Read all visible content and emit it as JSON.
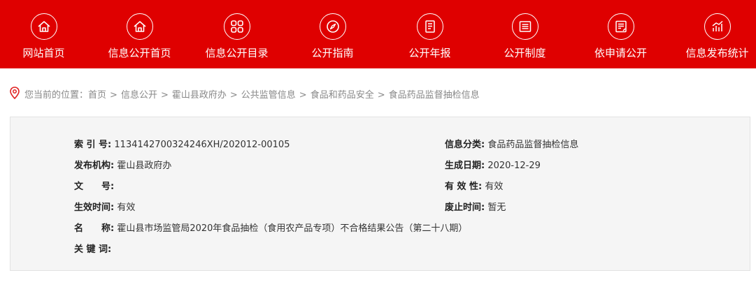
{
  "nav": {
    "items": [
      {
        "label": "网站首页",
        "icon": "home-icon"
      },
      {
        "label": "信息公开首页",
        "icon": "home-icon"
      },
      {
        "label": "信息公开目录",
        "icon": "grid-icon"
      },
      {
        "label": "公开指南",
        "icon": "compass-icon"
      },
      {
        "label": "公开年报",
        "icon": "document-icon"
      },
      {
        "label": "公开制度",
        "icon": "list-icon"
      },
      {
        "label": "依申请公开",
        "icon": "form-icon"
      },
      {
        "label": "信息发布统计",
        "icon": "chart-icon"
      }
    ]
  },
  "breadcrumb": {
    "prefix": "您当前的位置：",
    "items": [
      "首页",
      "信息公开",
      "霍山县政府办",
      "公共监管信息",
      "食品和药品安全",
      "食品药品监督抽检信息"
    ]
  },
  "info": {
    "index_label": "索 引 号:",
    "index_value": "1134142700324246XH/202012-00105",
    "category_label": "信息分类:",
    "category_value": "食品药品监督抽检信息",
    "publisher_label": "发布机构:",
    "publisher_value": "霍山县政府办",
    "date_label": "生成日期:",
    "date_value": "2020-12-29",
    "docno_label": "文　　号:",
    "docno_value": "",
    "validity_label": "有 效 性:",
    "validity_value": "有效",
    "effective_label": "生效时间:",
    "effective_value": "有效",
    "expire_label": "废止时间:",
    "expire_value": "暂无",
    "name_label": "名　　称:",
    "name_value": "霍山县市场监管局2020年食品抽检（食用农产品专项）不合格结果公告（第二十八期）",
    "keywords_label": "关 键 词:",
    "keywords_value": ""
  },
  "colors": {
    "nav_bg": "#df0000",
    "box_bg": "#f5f5f5"
  }
}
